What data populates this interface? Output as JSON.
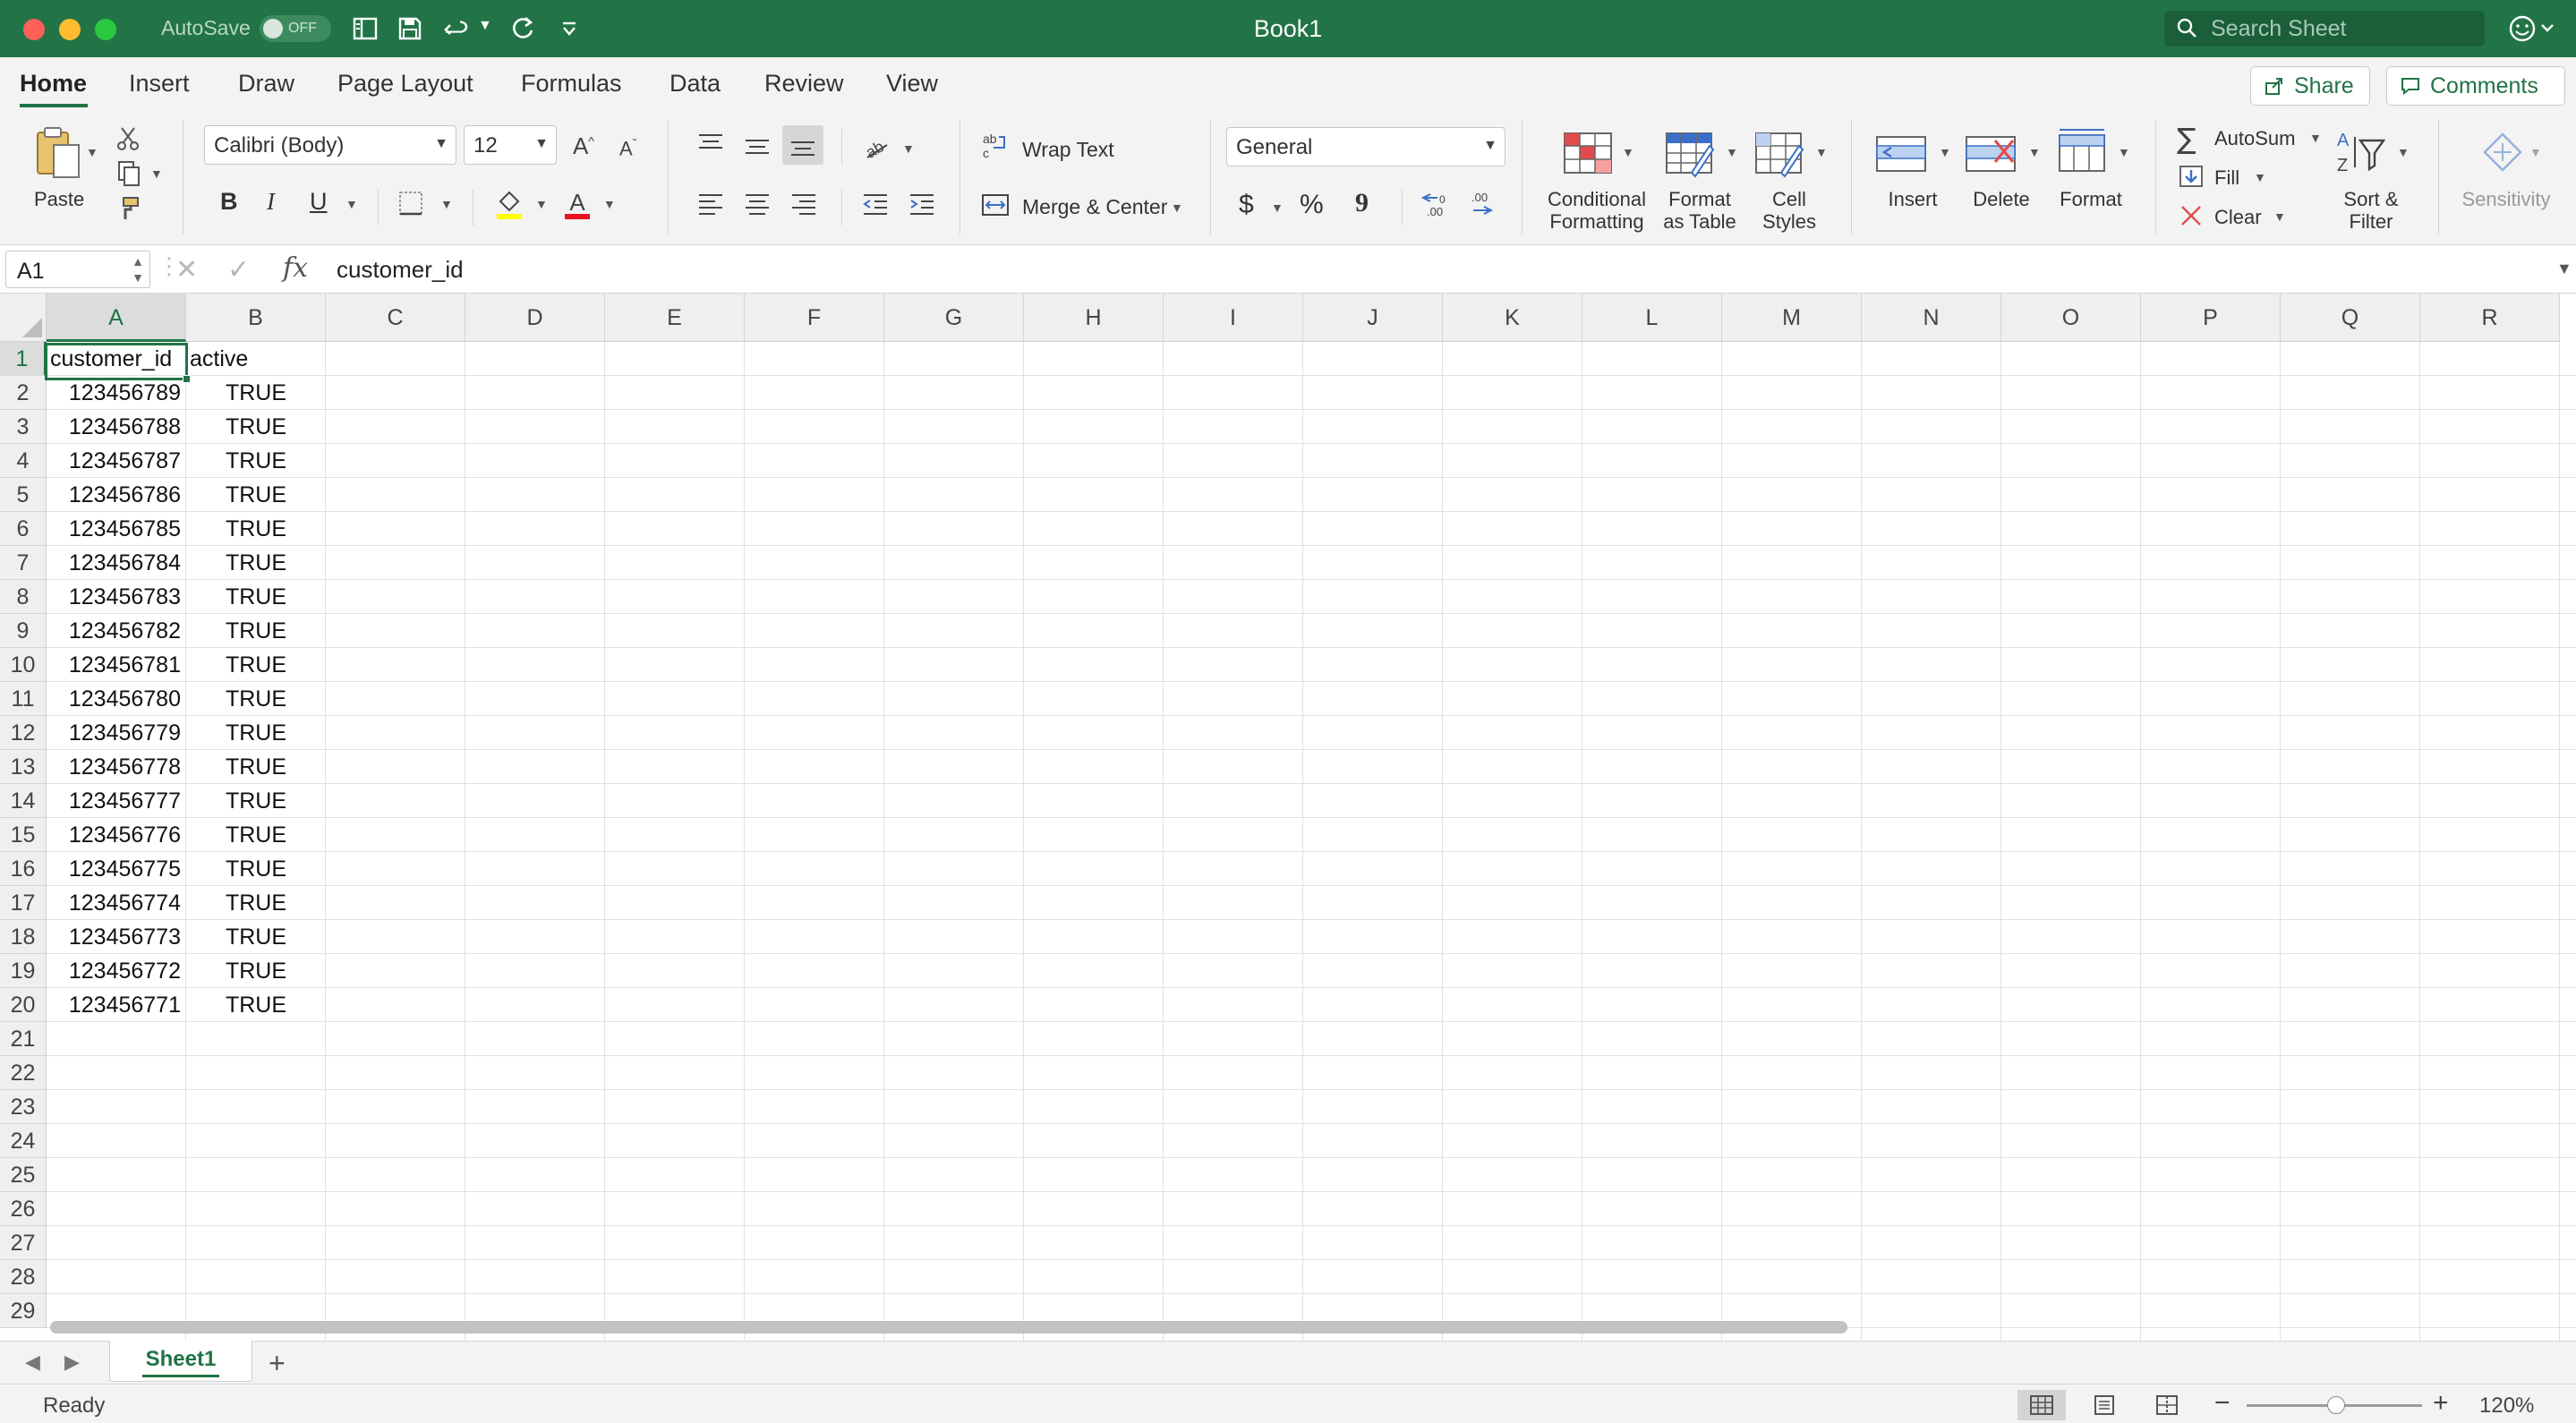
{
  "window": {
    "title": "Book1",
    "autosave_label": "AutoSave",
    "autosave_state": "OFF",
    "search_placeholder": "Search Sheet"
  },
  "ribbon_tabs": [
    "Home",
    "Insert",
    "Draw",
    "Page Layout",
    "Formulas",
    "Data",
    "Review",
    "View"
  ],
  "active_tab": "Home",
  "header_buttons": {
    "share": "Share",
    "comments": "Comments"
  },
  "ribbon": {
    "paste": "Paste",
    "font_name": "Calibri (Body)",
    "font_size": "12",
    "bold": "B",
    "italic": "I",
    "underline": "U",
    "wrap_text": "Wrap Text",
    "merge_center": "Merge & Center",
    "number_format": "General",
    "currency": "$",
    "percent": "%",
    "comma": "9",
    "conditional_formatting": [
      "Conditional",
      "Formatting"
    ],
    "format_as_table": [
      "Format",
      "as Table"
    ],
    "cell_styles": [
      "Cell",
      "Styles"
    ],
    "insert": "Insert",
    "delete": "Delete",
    "format": "Format",
    "autosum": "AutoSum",
    "fill": "Fill",
    "clear": "Clear",
    "sort_filter": [
      "Sort &",
      "Filter"
    ],
    "sensitivity": "Sensitivity"
  },
  "formula_bar": {
    "name_box": "A1",
    "fx": "fx",
    "content": "customer_id"
  },
  "grid": {
    "columns": [
      "A",
      "B",
      "C",
      "D",
      "E",
      "F",
      "G",
      "H",
      "I",
      "J",
      "K",
      "L",
      "M",
      "N",
      "O",
      "P",
      "Q",
      "R"
    ],
    "row_numbers": [
      "1",
      "2",
      "3",
      "4",
      "5",
      "6",
      "7",
      "8",
      "9",
      "10",
      "11",
      "12",
      "13",
      "14",
      "15",
      "16",
      "17",
      "18",
      "19",
      "20",
      "21",
      "22",
      "23",
      "24",
      "25",
      "26",
      "27",
      "28",
      "29"
    ],
    "selected_cell": "A1",
    "headers": [
      "customer_id",
      "active"
    ],
    "rows": [
      [
        "123456789",
        "TRUE"
      ],
      [
        "123456788",
        "TRUE"
      ],
      [
        "123456787",
        "TRUE"
      ],
      [
        "123456786",
        "TRUE"
      ],
      [
        "123456785",
        "TRUE"
      ],
      [
        "123456784",
        "TRUE"
      ],
      [
        "123456783",
        "TRUE"
      ],
      [
        "123456782",
        "TRUE"
      ],
      [
        "123456781",
        "TRUE"
      ],
      [
        "123456780",
        "TRUE"
      ],
      [
        "123456779",
        "TRUE"
      ],
      [
        "123456778",
        "TRUE"
      ],
      [
        "123456777",
        "TRUE"
      ],
      [
        "123456776",
        "TRUE"
      ],
      [
        "123456775",
        "TRUE"
      ],
      [
        "123456774",
        "TRUE"
      ],
      [
        "123456773",
        "TRUE"
      ],
      [
        "123456772",
        "TRUE"
      ],
      [
        "123456771",
        "TRUE"
      ]
    ]
  },
  "sheets": [
    "Sheet1"
  ],
  "active_sheet": "Sheet1",
  "status": {
    "text": "Ready",
    "zoom": "120%"
  },
  "colors": {
    "accent": "#217346",
    "titlebar": "#227447"
  },
  "icons": [
    "search-icon",
    "smiley-icon",
    "undo-icon",
    "redo-icon",
    "save-icon",
    "sidebar-icon"
  ]
}
